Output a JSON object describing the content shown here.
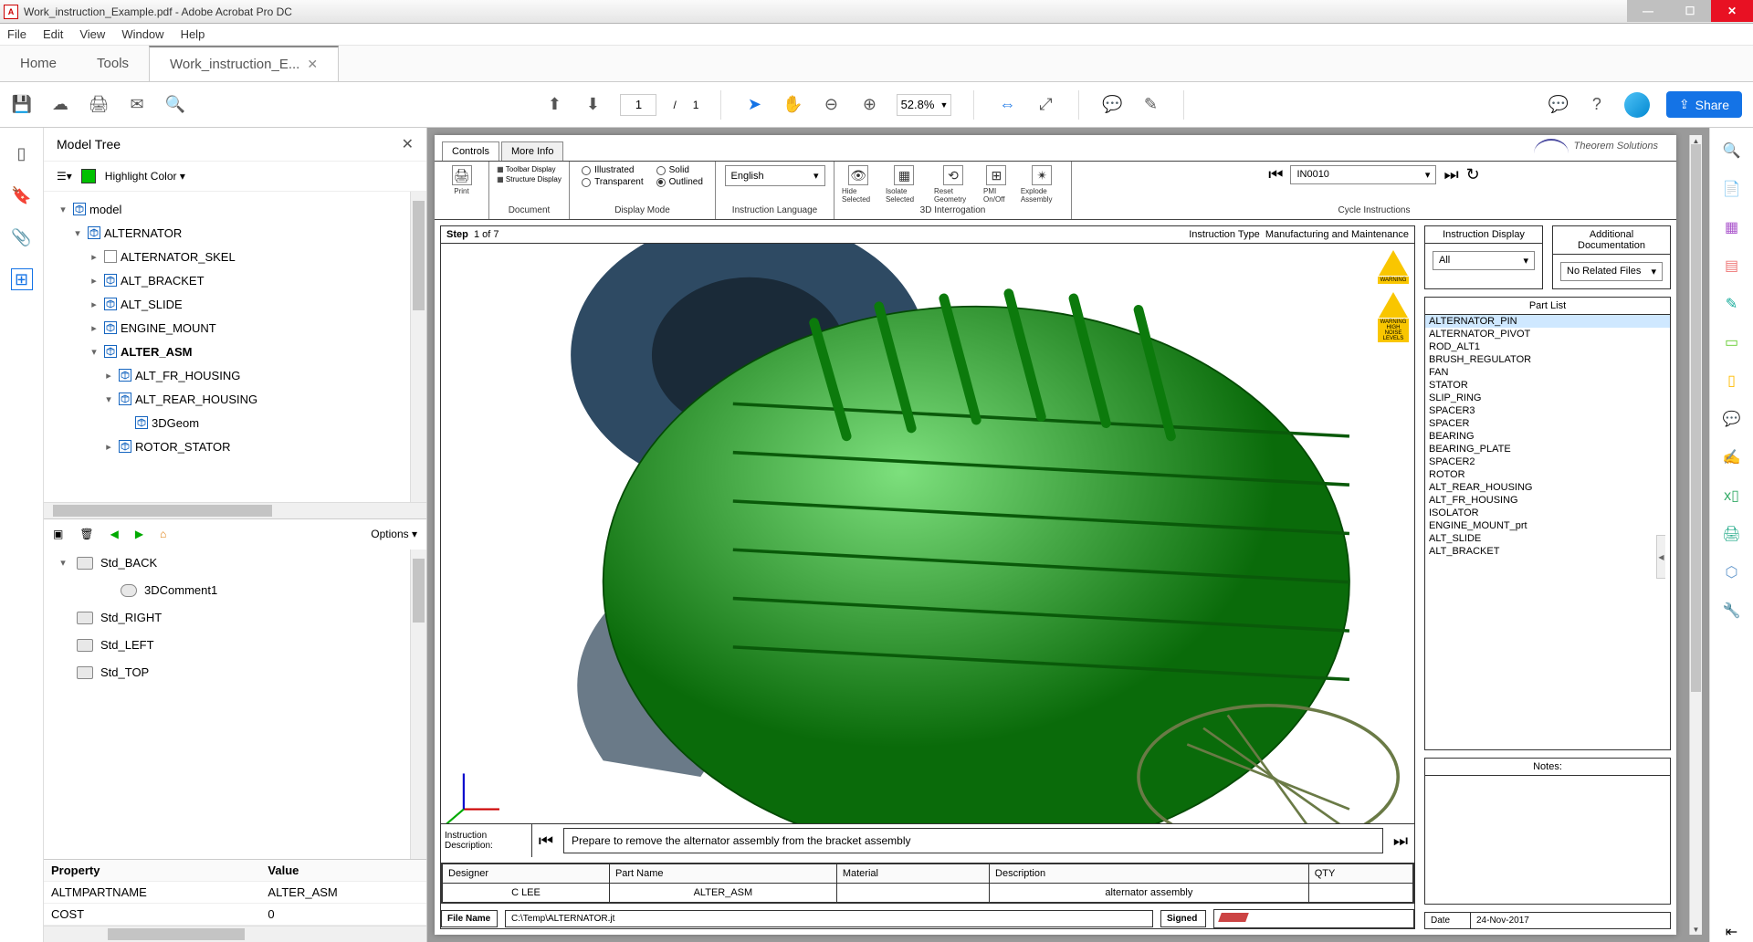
{
  "title_bar": {
    "title": "Work_instruction_Example.pdf - Adobe Acrobat Pro DC"
  },
  "menu": [
    "File",
    "Edit",
    "View",
    "Window",
    "Help"
  ],
  "tabs": {
    "home": "Home",
    "tools": "Tools",
    "doc": "Work_instruction_E..."
  },
  "toolbar": {
    "page_current": "1",
    "page_sep": "/",
    "page_total": "1",
    "zoom": "52.8%",
    "share": "Share"
  },
  "left_panel": {
    "title": "Model Tree",
    "highlight": "Highlight Color",
    "tree": [
      {
        "lvl": 0,
        "tw": "▾",
        "icon": "asm",
        "label": "model"
      },
      {
        "lvl": 1,
        "tw": "▾",
        "icon": "asm",
        "label": "ALTERNATOR"
      },
      {
        "lvl": 2,
        "tw": "▸",
        "icon": "page",
        "label": "ALTERNATOR_SKEL"
      },
      {
        "lvl": 2,
        "tw": "▸",
        "icon": "asm",
        "label": "ALT_BRACKET"
      },
      {
        "lvl": 2,
        "tw": "▸",
        "icon": "asm",
        "label": "ALT_SLIDE"
      },
      {
        "lvl": 2,
        "tw": "▸",
        "icon": "asm",
        "label": "ENGINE_MOUNT"
      },
      {
        "lvl": 2,
        "tw": "▾",
        "icon": "asm",
        "label": "ALTER_ASM",
        "bold": true
      },
      {
        "lvl": 3,
        "tw": "▸",
        "icon": "asm",
        "label": "ALT_FR_HOUSING"
      },
      {
        "lvl": 3,
        "tw": "▾",
        "icon": "asm",
        "label": "ALT_REAR_HOUSING"
      },
      {
        "lvl": 4,
        "tw": "",
        "icon": "asm",
        "label": "3DGeom"
      },
      {
        "lvl": 3,
        "tw": "▸",
        "icon": "asm",
        "label": "ROTOR_STATOR"
      }
    ],
    "options": "Options",
    "views": [
      {
        "tw": "▾",
        "icon": "cam",
        "label": "Std_BACK",
        "lvl": 0
      },
      {
        "tw": "",
        "icon": "comment",
        "label": "3DComment1",
        "lvl": 1
      },
      {
        "tw": "",
        "icon": "cam",
        "label": "Std_RIGHT",
        "lvl": 0
      },
      {
        "tw": "",
        "icon": "cam",
        "label": "Std_LEFT",
        "lvl": 0
      },
      {
        "tw": "",
        "icon": "cam",
        "label": "Std_TOP",
        "lvl": 0
      }
    ],
    "props": {
      "hdr_prop": "Property",
      "hdr_val": "Value",
      "rows": [
        {
          "p": "ALTMPARTNAME",
          "v": "ALTER_ASM"
        },
        {
          "p": "COST",
          "v": "0"
        }
      ]
    }
  },
  "pdf": {
    "tabs": [
      "Controls",
      "More Info"
    ],
    "brand": "Theorem Solutions",
    "groups": {
      "print": "Print",
      "doc": "Document",
      "toolbar_display": "Toolbar Display",
      "structure_display": "Structure Display",
      "display_mode": "Display Mode",
      "modes": {
        "illustrated": "Illustrated",
        "solid": "Solid",
        "transparent": "Transparent",
        "outlined": "Outlined"
      },
      "lang_label": "Instruction Language",
      "lang_value": "English",
      "interrog": "3D Interrogation",
      "interrog_items": [
        "Hide Selected",
        "Isolate Selected",
        "Reset Geometry",
        "PMI On/Off",
        "Explode Assembly"
      ],
      "cycle": "Cycle Instructions",
      "cycle_value": "IN0010"
    },
    "step": {
      "label": "Step",
      "value": "1 of 7",
      "type_label": "Instruction Type",
      "type_value": "Manufacturing and Maintenance"
    },
    "warn": [
      "WARNING",
      "WARNING HIGH NOISE LEVELS"
    ],
    "desc_label": "Instruction Description:",
    "desc_text": "Prepare to remove the alternator assembly from the bracket assembly",
    "meta_hdr": [
      "Designer",
      "Part Name",
      "Material",
      "Description",
      "QTY"
    ],
    "meta_row": {
      "designer": "C LEE",
      "part": "ALTER_ASM",
      "material": "",
      "desc": "alternator assembly",
      "qty": ""
    },
    "file_label": "File Name",
    "file_value": "C:\\Temp\\ALTERNATOR.jt",
    "signed_label": "Signed",
    "side": {
      "instr_display": "Instruction Display",
      "instr_value": "All",
      "add_doc": "Additional Documentation",
      "add_doc_value": "No Related Files",
      "part_list": "Part List",
      "parts": [
        "ALTERNATOR_PIN",
        "ALTERNATOR_PIVOT",
        "ROD_ALT1",
        "BRUSH_REGULATOR",
        "FAN",
        "STATOR",
        "SLIP_RING",
        "SPACER3",
        "SPACER",
        "BEARING",
        "BEARING_PLATE",
        "SPACER2",
        "ROTOR",
        "ALT_REAR_HOUSING",
        "ALT_FR_HOUSING",
        "ISOLATOR",
        "ENGINE_MOUNT_prt",
        "ALT_SLIDE",
        "ALT_BRACKET"
      ],
      "notes": "Notes:",
      "date_label": "Date",
      "date_value": "24-Nov-2017"
    }
  }
}
